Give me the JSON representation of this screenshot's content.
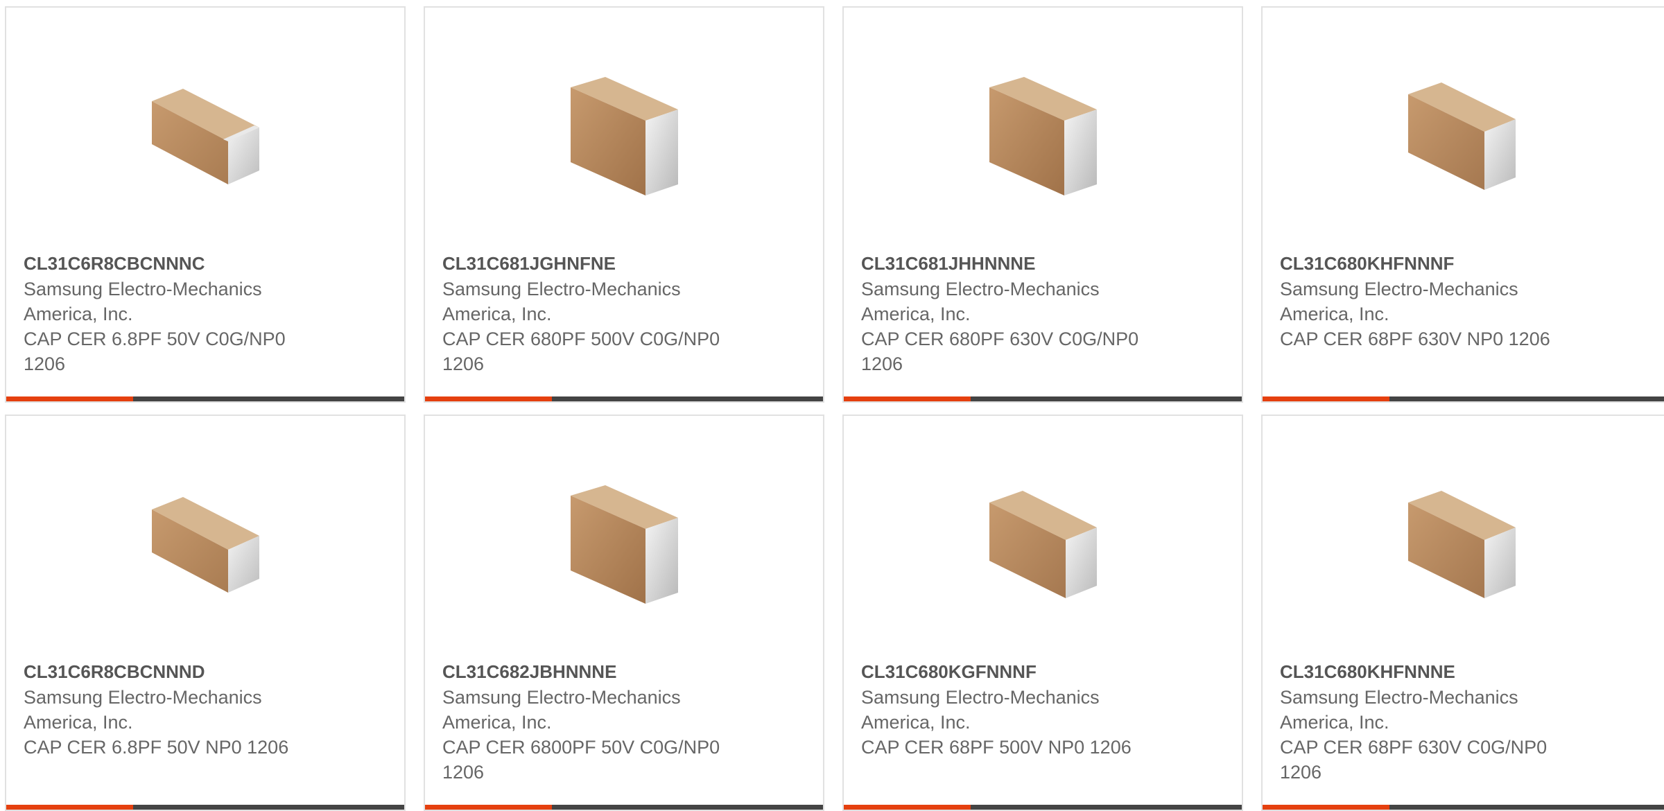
{
  "colors": {
    "accent": "#e5400f",
    "bar_dark": "#444444",
    "text": "#666666",
    "part_number": "#555555",
    "card_border": "#e1e1e1"
  },
  "products": [
    {
      "part_number": "CL31C6R8CBCNNNC",
      "manufacturer": "Samsung Electro-Mechanics America, Inc.",
      "description": "CAP CER 6.8PF 50V C0G/NP0 1206",
      "image_icon": "smd-capacitor-flat-icon"
    },
    {
      "part_number": "CL31C681JGHNFNE",
      "manufacturer": "Samsung Electro-Mechanics America, Inc.",
      "description": "CAP CER 680PF 500V C0G/NP0 1206",
      "image_icon": "smd-capacitor-tall-icon"
    },
    {
      "part_number": "CL31C681JHHNNNE",
      "manufacturer": "Samsung Electro-Mechanics America, Inc.",
      "description": "CAP CER 680PF 630V C0G/NP0 1206",
      "image_icon": "smd-capacitor-tall-icon"
    },
    {
      "part_number": "CL31C680KHFNNNF",
      "manufacturer": "Samsung Electro-Mechanics America, Inc.",
      "description": "CAP CER 68PF 630V NP0 1206",
      "image_icon": "smd-capacitor-medium-icon"
    },
    {
      "part_number": "CL31C6R8CBCNNND",
      "manufacturer": "Samsung Electro-Mechanics America, Inc.",
      "description": "CAP CER 6.8PF 50V NP0 1206",
      "image_icon": "smd-capacitor-flat-icon"
    },
    {
      "part_number": "CL31C682JBHNNNE",
      "manufacturer": "Samsung Electro-Mechanics America, Inc.",
      "description": "CAP CER 6800PF 50V C0G/NP0 1206",
      "image_icon": "smd-capacitor-tall-icon"
    },
    {
      "part_number": "CL31C680KGFNNNF",
      "manufacturer": "Samsung Electro-Mechanics America, Inc.",
      "description": "CAP CER 68PF 500V NP0 1206",
      "image_icon": "smd-capacitor-medium-icon"
    },
    {
      "part_number": "CL31C680KHFNNNE",
      "manufacturer": "Samsung Electro-Mechanics America, Inc.",
      "description": "CAP CER 68PF 630V C0G/NP0 1206",
      "image_icon": "smd-capacitor-medium-icon"
    }
  ]
}
